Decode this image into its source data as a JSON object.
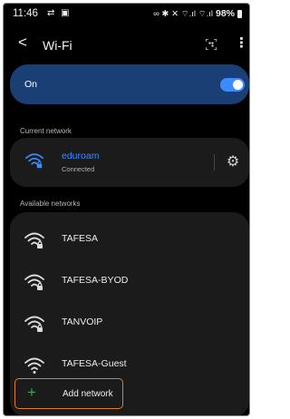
{
  "status_bar": {
    "time": "11:46",
    "left_icons": "⇄ ▣",
    "right_icons": "∞ ✱ ✕ ⌔.ıl ⌔.ıl",
    "battery": "98%"
  },
  "header": {
    "back_icon": "back-arrow-icon",
    "title": "Wi-Fi",
    "qr_icon": "qr-scan-icon",
    "more_icon": "more-vertical-icon"
  },
  "wifi_toggle": {
    "label": "On",
    "enabled": true,
    "accent": "#3d8bff",
    "card_color": "#1a3f75"
  },
  "current_network": {
    "section_label": "Current network",
    "name": "eduroam",
    "status": "Connected",
    "name_color": "#3d8bff",
    "settings_icon": "gear-icon"
  },
  "available_networks": {
    "section_label": "Available networks",
    "items": [
      {
        "name": "TAFESA",
        "secured": true
      },
      {
        "name": "TAFESA-BYOD",
        "secured": true
      },
      {
        "name": "TANVOIP",
        "secured": true
      },
      {
        "name": "TAFESA-Guest",
        "secured": false
      }
    ]
  },
  "add_network": {
    "label": "Add network",
    "highlight_color": "#e07a2e"
  }
}
